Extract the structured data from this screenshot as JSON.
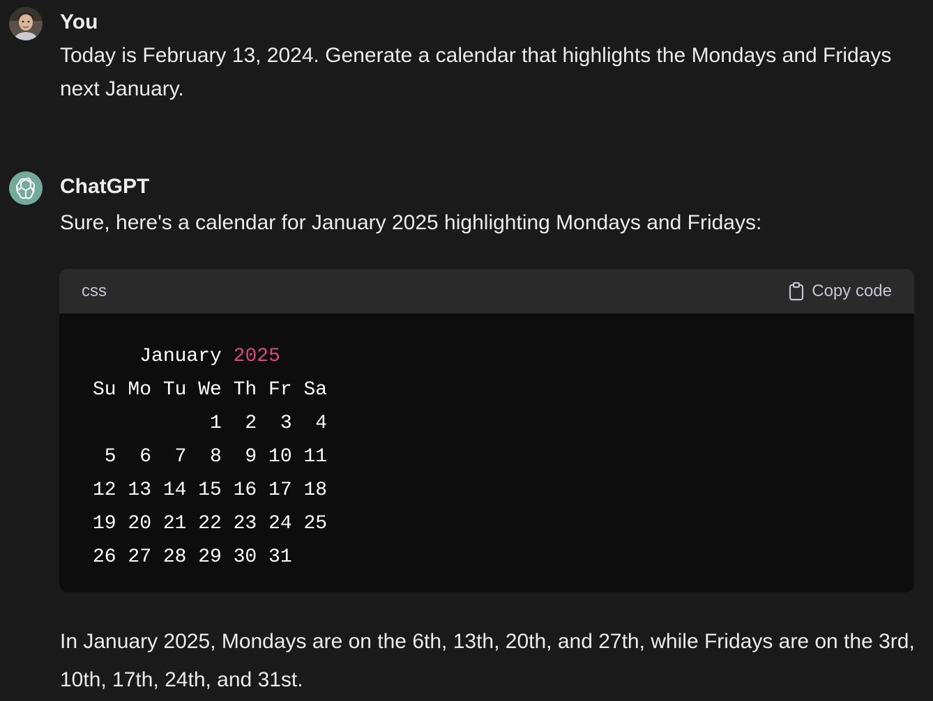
{
  "user_message": {
    "author": "You",
    "text": "Today is February 13, 2024. Generate a calendar that highlights the Mondays and Fridays next January."
  },
  "assistant_message": {
    "author": "ChatGPT",
    "intro": "Sure, here's a calendar for January 2025 highlighting Mondays and Fridays:",
    "code_block": {
      "language": "css",
      "copy_label": "Copy code",
      "month_label": "January",
      "year": "2025",
      "weekday_header": "Su Mo Tu We Th Fr Sa",
      "week_rows": [
        "          1  2  3  4",
        " 5  6  7  8  9 10 11",
        "12 13 14 15 16 17 18",
        "19 20 21 22 23 24 25",
        "26 27 28 29 30 31"
      ]
    },
    "outro": "In January 2025, Mondays are on the 6th, 13th, 20th, and 27th, while Fridays are on the 3rd, 10th, 17th, 24th, and 31st."
  },
  "colors": {
    "background": "#1a1a1a",
    "code_background": "#0d0d0d",
    "code_header": "#2a2a2a",
    "number_highlight": "#d7497f",
    "assistant_avatar": "#74aa9c"
  },
  "icons": {
    "user_avatar": "user-photo",
    "assistant_avatar": "openai-logo-icon",
    "copy": "clipboard-icon"
  }
}
